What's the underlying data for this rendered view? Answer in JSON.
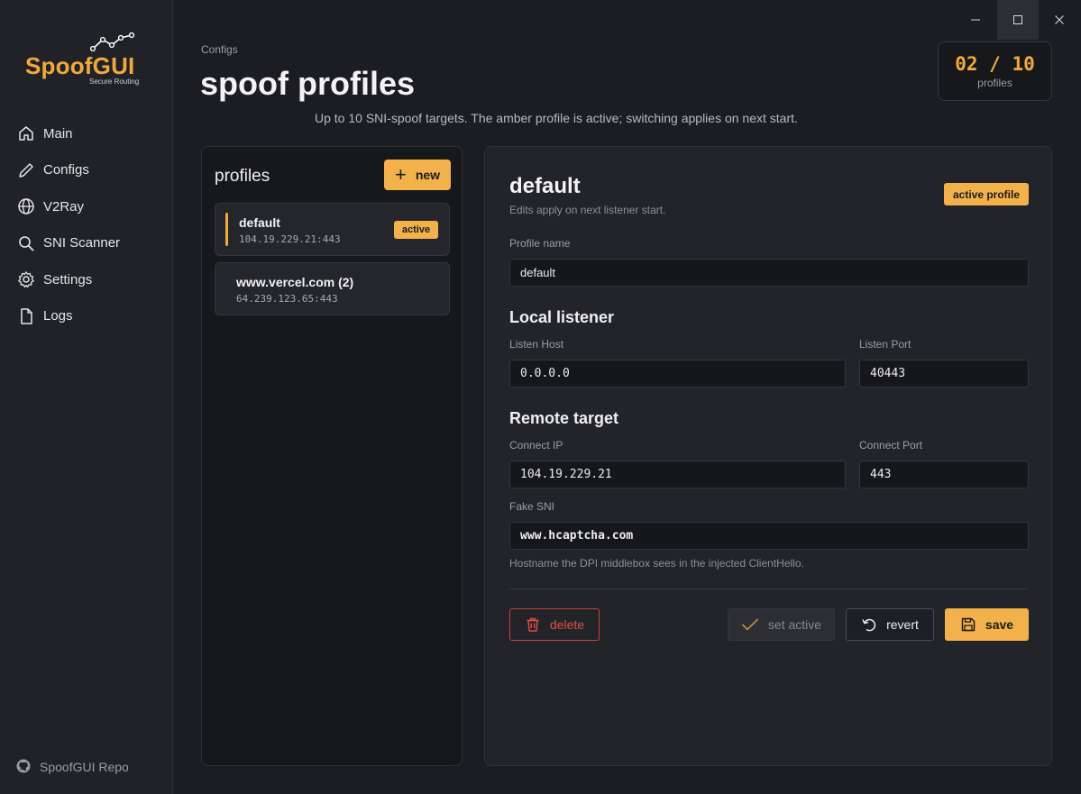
{
  "window": {
    "minimize_label": "—",
    "maximize_label": "□",
    "close_label": "✕"
  },
  "sidebar": {
    "logo_text": "SpoofGUI",
    "logo_sub": "Secure Routing",
    "items": [
      {
        "label": "Main",
        "icon": "home-icon"
      },
      {
        "label": "Configs",
        "icon": "pencil-icon"
      },
      {
        "label": "V2Ray",
        "icon": "globe-icon"
      },
      {
        "label": "SNI Scanner",
        "icon": "search-icon"
      },
      {
        "label": "Settings",
        "icon": "gear-icon"
      },
      {
        "label": "Logs",
        "icon": "file-icon"
      }
    ],
    "repo_label": "SpoofGUI Repo",
    "repo_icon": "github-icon"
  },
  "header": {
    "breadcrumb": "Configs",
    "title": "spoof profiles",
    "description": "Up to 10 SNI-spoof targets. The amber profile is active; switching applies on next start.",
    "counter_value": "02 / 10",
    "counter_label": "profiles"
  },
  "profiles_panel": {
    "title": "profiles",
    "new_button": "new",
    "items": [
      {
        "name": "default",
        "address": "104.19.229.21:443",
        "badge": "active"
      },
      {
        "name": "www.vercel.com (2)",
        "address": "64.239.123.65:443"
      }
    ]
  },
  "editor": {
    "title": "default",
    "subtitle": "Edits apply on next listener start.",
    "badge": "active profile",
    "profile_name_label": "Profile name",
    "profile_name_value": "default",
    "local_listener_heading": "Local listener",
    "listen_host_label": "Listen Host",
    "listen_host_value": "0.0.0.0",
    "listen_port_label": "Listen Port",
    "listen_port_value": "40443",
    "remote_target_heading": "Remote target",
    "connect_ip_label": "Connect IP",
    "connect_ip_value": "104.19.229.21",
    "connect_port_label": "Connect Port",
    "connect_port_value": "443",
    "fake_sni_label": "Fake SNI",
    "fake_sni_value": "www.hcaptcha.com",
    "fake_sni_hint": "Hostname the DPI middlebox sees in the injected ClientHello.",
    "delete_label": "delete",
    "set_active_label": "set active",
    "revert_label": "revert",
    "save_label": "save"
  },
  "colors": {
    "accent": "#f2a93b",
    "danger": "#e0523e",
    "background": "#1b1d23",
    "panel": "#22242a"
  }
}
